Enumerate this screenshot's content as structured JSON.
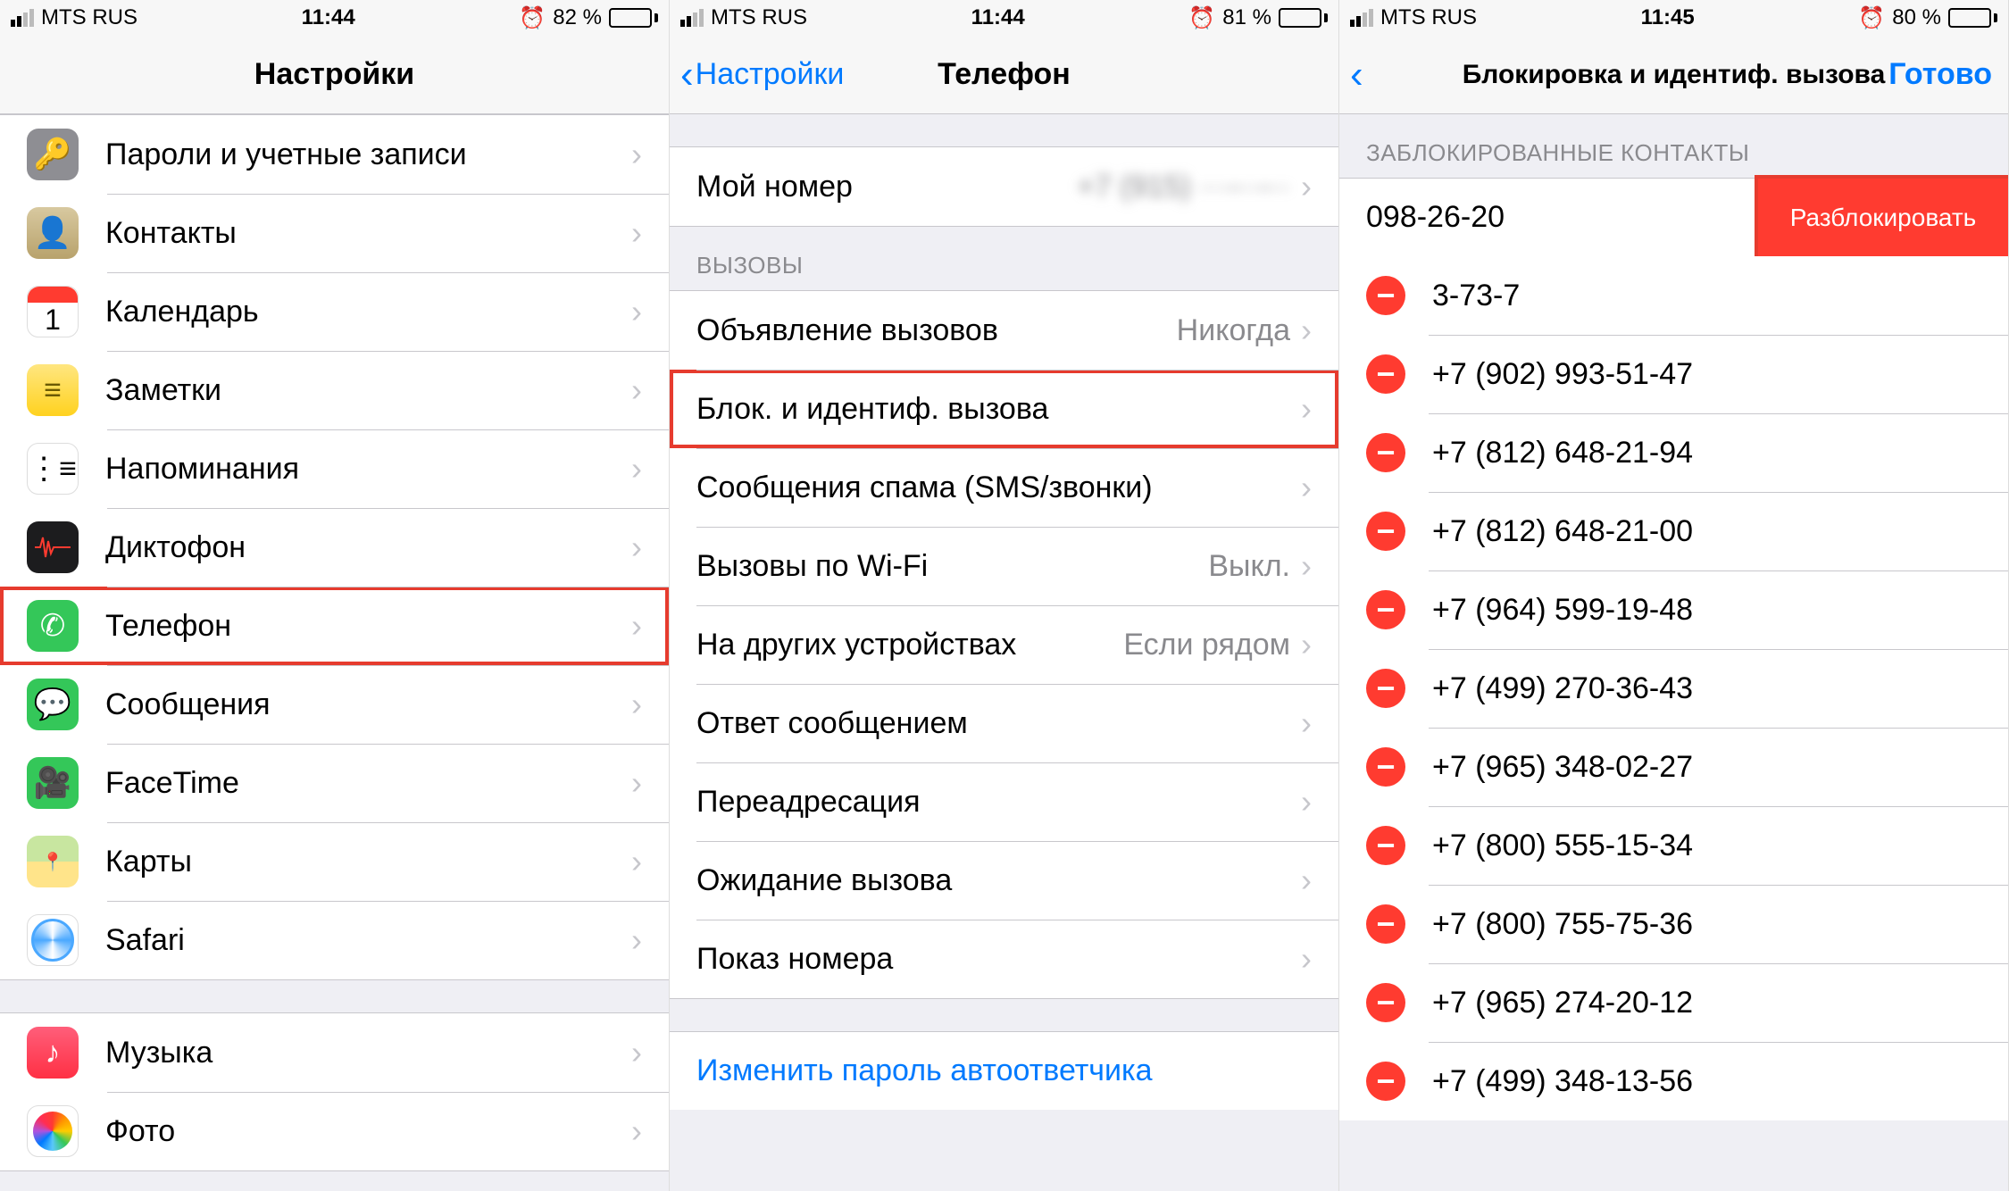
{
  "screen1": {
    "status": {
      "carrier": "MTS RUS",
      "time": "11:44",
      "battery_pct": "82 %",
      "battery_fill": 82
    },
    "nav": {
      "title": "Настройки"
    },
    "rows": [
      {
        "id": "passwords",
        "label": "Пароли и учетные записи",
        "icon": "key-icon",
        "iconClass": "bg-grey"
      },
      {
        "id": "contacts",
        "label": "Контакты",
        "icon": "contacts-icon",
        "iconClass": "bg-contacts"
      },
      {
        "id": "calendar",
        "label": "Календарь",
        "icon": "calendar-icon",
        "iconClass": "bg-calendar"
      },
      {
        "id": "notes",
        "label": "Заметки",
        "icon": "notes-icon",
        "iconClass": "bg-notes"
      },
      {
        "id": "reminders",
        "label": "Напоминания",
        "icon": "reminders-icon",
        "iconClass": "bg-reminders"
      },
      {
        "id": "voicememos",
        "label": "Диктофон",
        "icon": "voice-memos-icon",
        "iconClass": "bg-voice"
      },
      {
        "id": "phone",
        "label": "Телефон",
        "icon": "phone-icon",
        "iconClass": "bg-phone",
        "highlight": true
      },
      {
        "id": "messages",
        "label": "Сообщения",
        "icon": "messages-icon",
        "iconClass": "bg-messages"
      },
      {
        "id": "facetime",
        "label": "FaceTime",
        "icon": "facetime-icon",
        "iconClass": "bg-facetime"
      },
      {
        "id": "maps",
        "label": "Карты",
        "icon": "maps-icon",
        "iconClass": "bg-maps"
      },
      {
        "id": "safari",
        "label": "Safari",
        "icon": "safari-icon",
        "iconClass": "bg-safari"
      }
    ],
    "rows2": [
      {
        "id": "music",
        "label": "Музыка",
        "icon": "music-icon",
        "iconClass": "bg-music"
      },
      {
        "id": "photos",
        "label": "Фото",
        "icon": "photos-icon",
        "iconClass": "bg-photos"
      }
    ]
  },
  "screen2": {
    "status": {
      "carrier": "MTS RUS",
      "time": "11:44",
      "battery_pct": "81 %",
      "battery_fill": 81
    },
    "nav": {
      "back": "Настройки",
      "title": "Телефон"
    },
    "my_number": {
      "label": "Мой номер",
      "value": "+7 (915) ···-··-··"
    },
    "section_calls": "ВЫЗОВЫ",
    "rows": [
      {
        "id": "announce",
        "label": "Объявление вызовов",
        "value": "Никогда"
      },
      {
        "id": "block",
        "label": "Блок. и идентиф. вызова",
        "highlight": true
      },
      {
        "id": "spam",
        "label": "Сообщения спама (SMS/звонки)"
      },
      {
        "id": "wifi",
        "label": "Вызовы по Wi-Fi",
        "value": "Выкл."
      },
      {
        "id": "other",
        "label": "На других устройствах",
        "value": "Если рядом"
      },
      {
        "id": "reply",
        "label": "Ответ сообщением"
      },
      {
        "id": "forward",
        "label": "Переадресация"
      },
      {
        "id": "waiting",
        "label": "Ожидание вызова"
      },
      {
        "id": "callerid",
        "label": "Показ номера"
      }
    ],
    "link": "Изменить пароль автоответчика"
  },
  "screen3": {
    "status": {
      "carrier": "MTS RUS",
      "time": "11:45",
      "battery_pct": "80 %",
      "battery_fill": 80
    },
    "nav": {
      "title": "Блокировка и идентиф. вызова",
      "right": "Готово"
    },
    "section": "ЗАБЛОКИРОВАННЫЕ КОНТАКТЫ",
    "first_number": "098-26-20",
    "unblock": "Разблокировать",
    "numbers": [
      "3-73-7",
      "+7 (902) 993-51-47",
      "+7 (812) 648-21-94",
      "+7 (812) 648-21-00",
      "+7 (964) 599-19-48",
      "+7 (499) 270-36-43",
      "+7 (965) 348-02-27",
      "+7 (800) 555-15-34",
      "+7 (800) 755-75-36",
      "+7 (965) 274-20-12",
      "+7 (499) 348-13-56"
    ]
  }
}
